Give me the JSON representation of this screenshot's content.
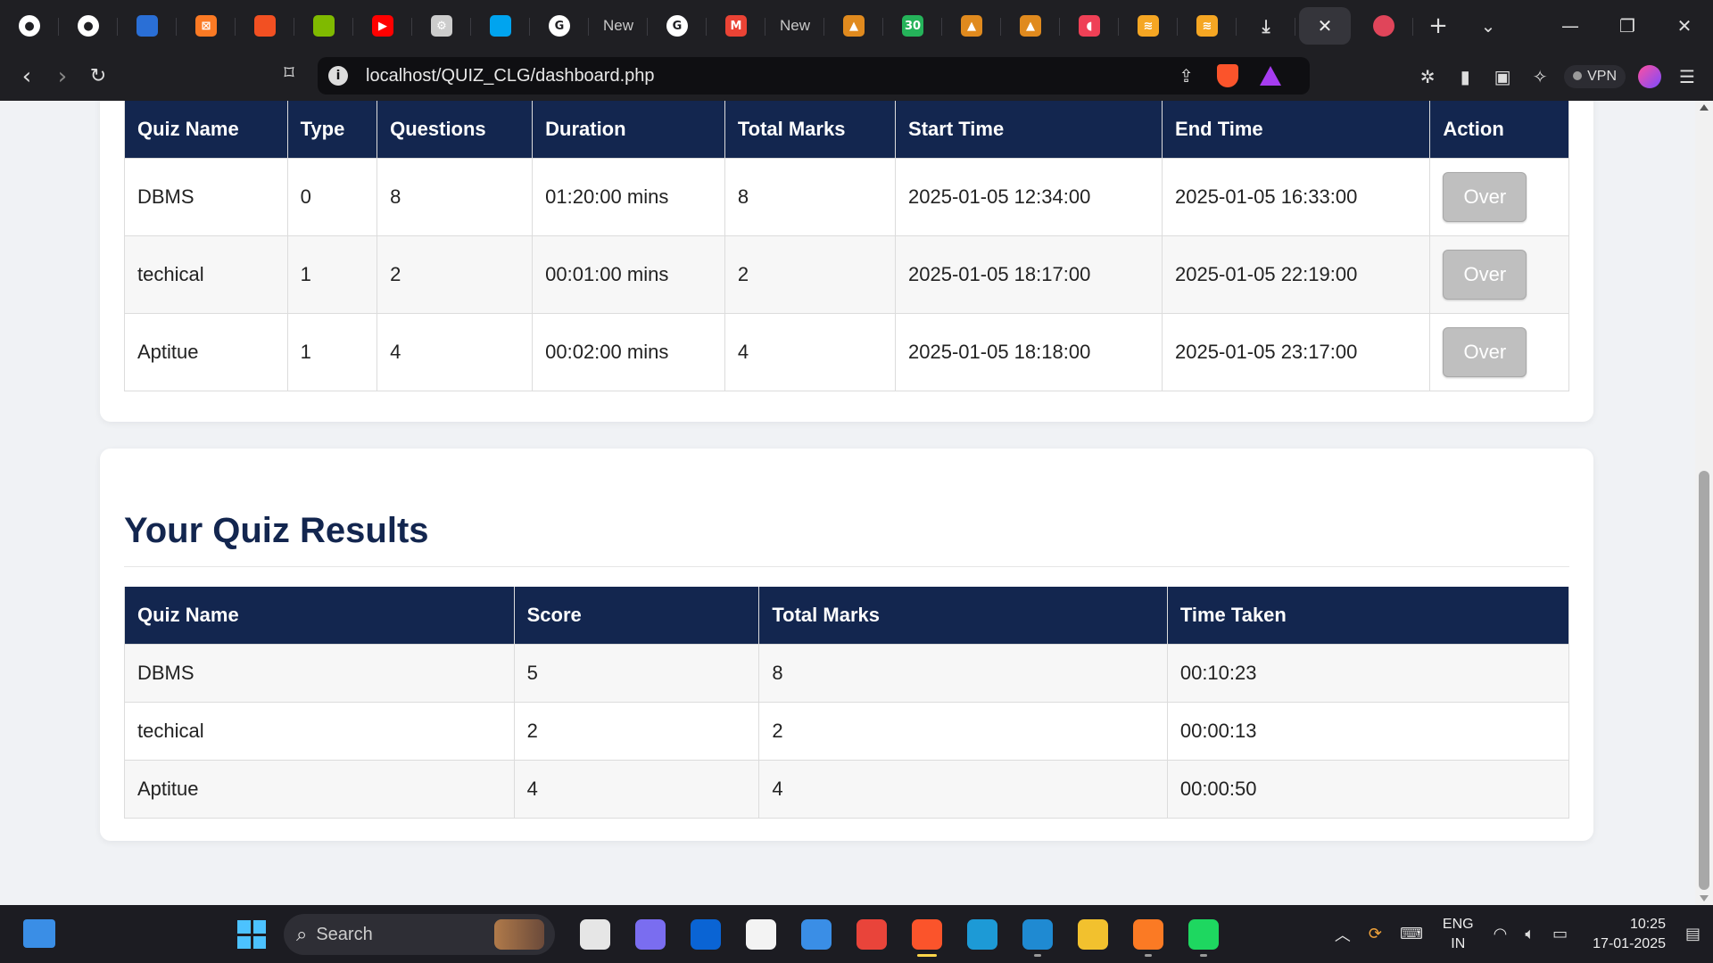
{
  "browser": {
    "tabs": [
      {
        "name": "github-tab",
        "color": "#ffffff",
        "glyph": "●",
        "title": ""
      },
      {
        "name": "github-tab-2",
        "color": "#ffffff",
        "glyph": "●",
        "title": ""
      },
      {
        "name": "app-tab",
        "color": "#2a6fd6",
        "glyph": "",
        "title": ""
      },
      {
        "name": "xampp-tab",
        "color": "#fb7a24",
        "glyph": "⊠",
        "title": ""
      },
      {
        "name": "microsoft-tab",
        "color": "#f25022",
        "glyph": "",
        "title": ""
      },
      {
        "name": "microsoft-tab-2",
        "color": "#7fba00",
        "glyph": "",
        "title": ""
      },
      {
        "name": "youtube-tab",
        "color": "#ff0000",
        "glyph": "▶",
        "title": ""
      },
      {
        "name": "chatgpt-tab",
        "color": "#cccccc",
        "glyph": "⚙",
        "title": ""
      },
      {
        "name": "microsoft-tab-3",
        "color": "#00a4ef",
        "glyph": "",
        "title": ""
      },
      {
        "name": "google-tab",
        "color": "#ffffff",
        "glyph": "G",
        "title": ""
      },
      {
        "name": "new-tab",
        "color": "",
        "glyph": "",
        "title": "New"
      },
      {
        "name": "google-tab-2",
        "color": "#ffffff",
        "glyph": "G",
        "title": ""
      },
      {
        "name": "gmail-tab",
        "color": "#ea4335",
        "glyph": "M",
        "title": ""
      },
      {
        "name": "new-tab-2",
        "color": "",
        "glyph": "",
        "title": "New"
      },
      {
        "name": "site-tab",
        "color": "#e08a1e",
        "glyph": "▲",
        "title": ""
      },
      {
        "name": "timer-tab",
        "color": "#25b35a",
        "glyph": "30",
        "title": ""
      },
      {
        "name": "site-tab-2",
        "color": "#e08a1e",
        "glyph": "▲",
        "title": ""
      },
      {
        "name": "site-tab-3",
        "color": "#e08a1e",
        "glyph": "▲",
        "title": ""
      },
      {
        "name": "pocket-tab",
        "color": "#ef4056",
        "glyph": "◖",
        "title": ""
      },
      {
        "name": "brand-tab",
        "color": "#f5a623",
        "glyph": "≋",
        "title": ""
      },
      {
        "name": "brand-tab-2",
        "color": "#f5a623",
        "glyph": "≋",
        "title": ""
      },
      {
        "name": "download-tab",
        "color": "",
        "glyph": "⤓",
        "title": ""
      }
    ],
    "active_tab_close": "✕",
    "url": "localhost/QUIZ_CLG/dashboard.php",
    "vpn_label": "VPN"
  },
  "quizzes_table": {
    "headers": [
      "Quiz Name",
      "Type",
      "Questions",
      "Duration",
      "Total Marks",
      "Start Time",
      "End Time",
      "Action"
    ],
    "rows": [
      [
        "DBMS",
        "0",
        "8",
        "01:20:00 mins",
        "8",
        "2025-01-05 12:34:00",
        "2025-01-05 16:33:00",
        "Over"
      ],
      [
        "techical",
        "1",
        "2",
        "00:01:00 mins",
        "2",
        "2025-01-05 18:17:00",
        "2025-01-05 22:19:00",
        "Over"
      ],
      [
        "Aptitue",
        "1",
        "4",
        "00:02:00 mins",
        "4",
        "2025-01-05 18:18:00",
        "2025-01-05 23:17:00",
        "Over"
      ]
    ]
  },
  "results": {
    "title": "Your Quiz Results",
    "headers": [
      "Quiz Name",
      "Score",
      "Total Marks",
      "Time Taken"
    ],
    "rows": [
      [
        "DBMS",
        "5",
        "8",
        "00:10:23"
      ],
      [
        "techical",
        "2",
        "2",
        "00:00:13"
      ],
      [
        "Aptitue",
        "4",
        "4",
        "00:00:50"
      ]
    ]
  },
  "taskbar": {
    "search_label": "Search",
    "apps": [
      {
        "name": "task-view-app",
        "color": "#e6e6e6",
        "running": false
      },
      {
        "name": "copilot-app",
        "color": "#7a6df0",
        "running": false
      },
      {
        "name": "outlook-app",
        "color": "#0a64d4",
        "running": false
      },
      {
        "name": "store-app",
        "color": "#f3f3f3",
        "running": false
      },
      {
        "name": "notepad-app",
        "color": "#3a8ee6",
        "running": false
      },
      {
        "name": "chrome-app",
        "color": "#e9443a",
        "running": false
      },
      {
        "name": "brave-app",
        "color": "#fb542b",
        "running": true
      },
      {
        "name": "edge-app",
        "color": "#1d9ad6",
        "running": false
      },
      {
        "name": "vscode-app",
        "color": "#1f8ad2",
        "running": true
      },
      {
        "name": "file-explorer-app",
        "color": "#f2c12e",
        "running": false
      },
      {
        "name": "xampp-app",
        "color": "#fb7a24",
        "running": true
      },
      {
        "name": "spotify-app",
        "color": "#1ed760",
        "running": true
      }
    ],
    "language": "ENG",
    "region": "IN",
    "time": "10:25",
    "date": "17-01-2025"
  }
}
